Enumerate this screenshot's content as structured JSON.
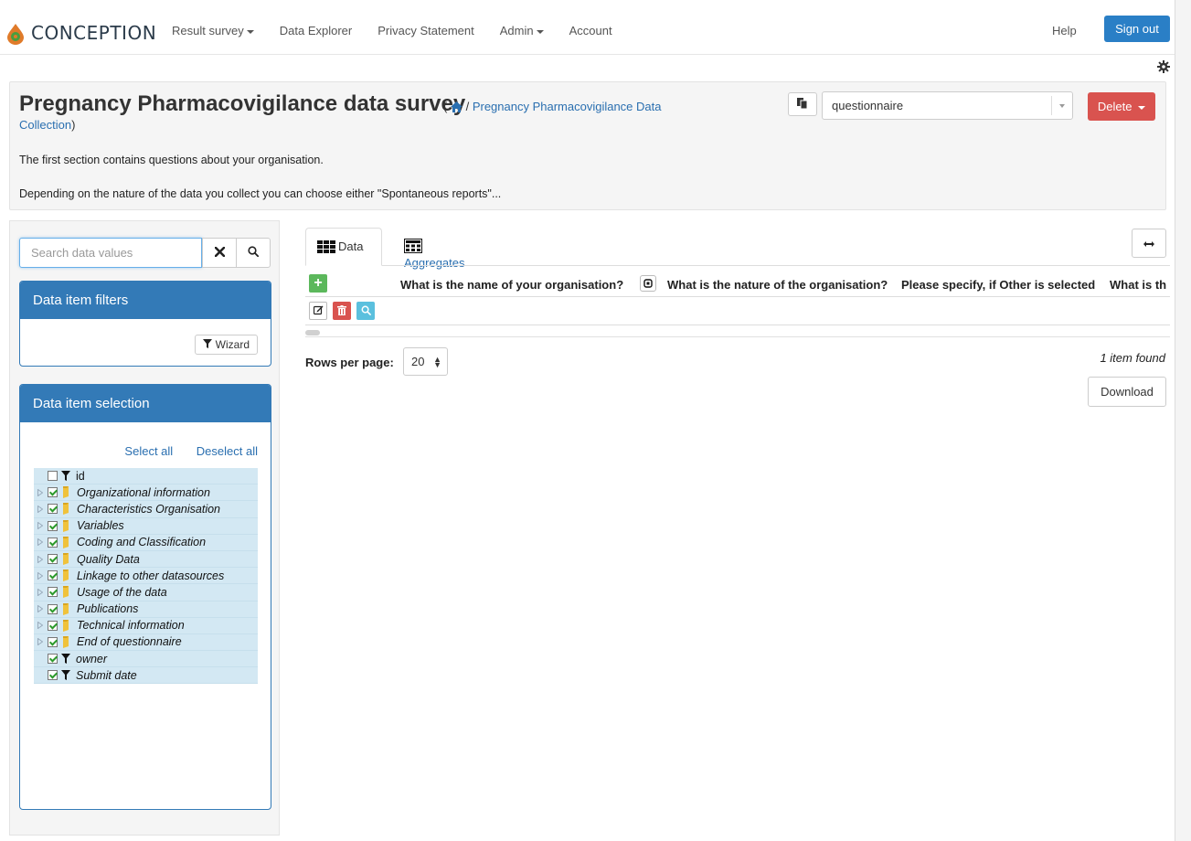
{
  "navbar": {
    "brand": "CONCEPTION",
    "items": [
      {
        "label": "Result survey",
        "dropdown": true
      },
      {
        "label": "Data Explorer",
        "dropdown": false
      },
      {
        "label": "Privacy Statement",
        "dropdown": false
      },
      {
        "label": "Admin",
        "dropdown": true
      },
      {
        "label": "Account",
        "dropdown": false
      }
    ],
    "help": "Help",
    "sign_out": "Sign out"
  },
  "header": {
    "title": "Pregnancy Pharmacovigilance data survey",
    "breadcrumb_open": "(",
    "breadcrumb_sep": " / ",
    "breadcrumb_link_part1": "Pregnancy Pharmacovigilance Data",
    "breadcrumb_link_part2": "Collection",
    "breadcrumb_close": ")",
    "questionnaire_select": "questionnaire",
    "delete_label": "Delete",
    "description_1": "The first section contains questions about your organisation.",
    "description_2": "Depending on the nature of the data you collect you can choose either \"Spontaneous reports\"..."
  },
  "sidebar": {
    "search_placeholder": "Search data values",
    "filters_title": "Data item filters",
    "wizard_label": "Wizard",
    "selection_title": "Data item selection",
    "select_all": "Select all",
    "deselect_all": "Deselect all",
    "tree": [
      {
        "label": "id",
        "type": "field",
        "checked": false
      },
      {
        "label": "Organizational information",
        "type": "folder",
        "checked": true
      },
      {
        "label": "Characteristics Organisation",
        "type": "folder",
        "checked": true
      },
      {
        "label": "Variables",
        "type": "folder",
        "checked": true
      },
      {
        "label": "Coding and Classification",
        "type": "folder",
        "checked": true
      },
      {
        "label": "Quality Data",
        "type": "folder",
        "checked": true
      },
      {
        "label": "Linkage to other datasources",
        "type": "folder",
        "checked": true
      },
      {
        "label": "Usage of the data",
        "type": "folder",
        "checked": true
      },
      {
        "label": "Publications",
        "type": "folder",
        "checked": true
      },
      {
        "label": "Technical information",
        "type": "folder",
        "checked": true
      },
      {
        "label": "End of questionnaire",
        "type": "folder",
        "checked": true
      },
      {
        "label": "owner",
        "type": "field",
        "checked": true
      },
      {
        "label": "Submit date",
        "type": "field",
        "checked": true
      }
    ]
  },
  "main": {
    "tabs": [
      {
        "label": "Data",
        "active": true
      },
      {
        "label": "Aggregates",
        "active": false
      }
    ],
    "columns": [
      "What is the name of your organisation?",
      "What is the nature of the organisation?",
      "Please specify, if Other is selected",
      "What is th"
    ],
    "rows_per_page_label": "Rows per page:",
    "rows_per_page_value": "20",
    "items_found": "1 item found",
    "download_label": "Download"
  },
  "colors": {
    "primary": "#337ab7",
    "sign_out": "#2a7fc6",
    "danger": "#d9534f",
    "success": "#5cb85c",
    "info": "#5bc0de",
    "tree_row": "#d3e8f3"
  }
}
